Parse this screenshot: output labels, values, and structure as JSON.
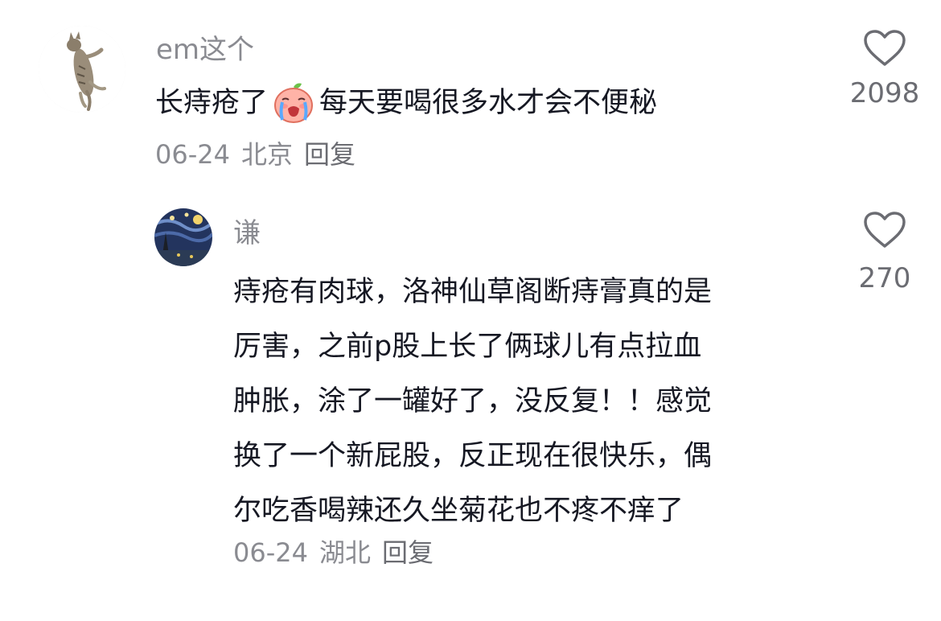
{
  "comments": [
    {
      "username": "em这个",
      "text_before_emoji": "长痔疮了",
      "emoji": "crying-peach-emoji",
      "text_after_emoji": "每天要喝很多水才会不便秘",
      "date": "06-24",
      "location": "北京",
      "reply_label": "回复",
      "like_count": "2098"
    }
  ],
  "reply": {
    "username": "谦",
    "text_lines": [
      "痔疮有肉球，洛神仙草阁断痔膏真的是",
      "厉害，之前p股上长了俩球儿有点拉血",
      "肿胀，涂了一罐好了，没反复！！感觉",
      "换了一个新屁股，反正现在很快乐，偶",
      "尔吃香喝辣还久坐菊花也不疼不痒了"
    ],
    "date": "06-24",
    "location": "湖北",
    "reply_label": "回复",
    "like_count": "270"
  },
  "colors": {
    "text_primary": "#161823",
    "text_secondary": "#8a8b91",
    "heart_outline": "#6b6c72"
  },
  "icons": {
    "like": "heart-outline-icon",
    "emoji": "crying-peach-emoji"
  }
}
